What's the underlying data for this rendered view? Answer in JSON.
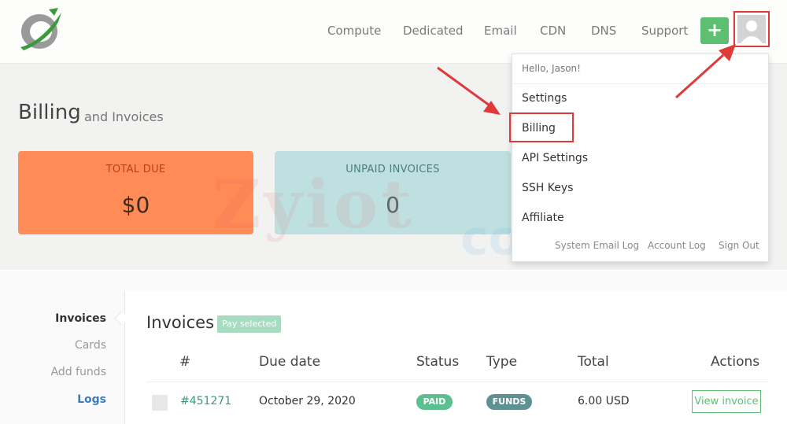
{
  "nav": {
    "items": [
      "Compute",
      "Dedicated",
      "Email",
      "CDN",
      "DNS",
      "Support"
    ],
    "plus_label": "+"
  },
  "header": {
    "title": "Billing",
    "subtitle": "and Invoices"
  },
  "cards": {
    "total_due": {
      "label": "TOTAL DUE",
      "value": "$0"
    },
    "unpaid_invoices": {
      "label": "UNPAID INVOICES",
      "value": "0"
    }
  },
  "watermark": {
    "text": "Zyiot",
    "text2": "com"
  },
  "dropdown": {
    "greeting": "Hello, Jason!",
    "items": [
      "Settings",
      "Billing",
      "API Settings",
      "SSH Keys",
      "Affiliate"
    ],
    "footer": [
      "System Email Log",
      "Account Log",
      "Sign Out"
    ]
  },
  "sidebar": {
    "items": [
      "Invoices",
      "Cards",
      "Add funds",
      "Logs"
    ]
  },
  "invoices": {
    "title": "Invoices",
    "pay_selected_label": "Pay selected",
    "columns": [
      "#",
      "Due date",
      "Status",
      "Type",
      "Total",
      "Actions"
    ],
    "rows": [
      {
        "id": "#451271",
        "due_date": "October 29, 2020",
        "status": "PAID",
        "type": "FUNDS",
        "total": "6.00 USD",
        "action": "View invoice"
      }
    ]
  },
  "colors": {
    "accent_green": "#5cbf72",
    "total_due_card": "#ff8b57",
    "unpaid_card": "#bfe0e0",
    "highlight_red": "#e0393a"
  }
}
